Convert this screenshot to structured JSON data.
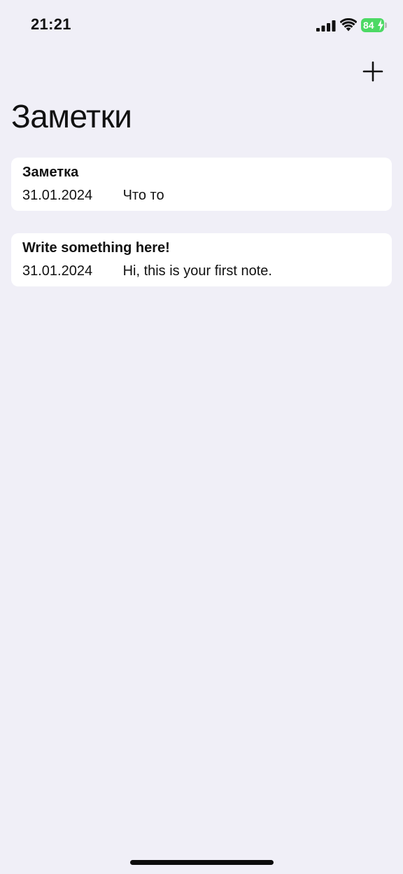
{
  "status_bar": {
    "time": "21:21",
    "battery_level": "84",
    "battery_color": "#4cd964"
  },
  "toolbar": {
    "add_icon": "plus-icon"
  },
  "header": {
    "title": "Заметки"
  },
  "notes": [
    {
      "title": "Заметка",
      "date": "31.01.2024",
      "preview": "Что то"
    },
    {
      "title": "Write something here!",
      "date": "31.01.2024",
      "preview": "Hi, this is your first note."
    }
  ],
  "colors": {
    "background": "#f0eff7",
    "card": "#ffffff",
    "text": "#111111"
  }
}
